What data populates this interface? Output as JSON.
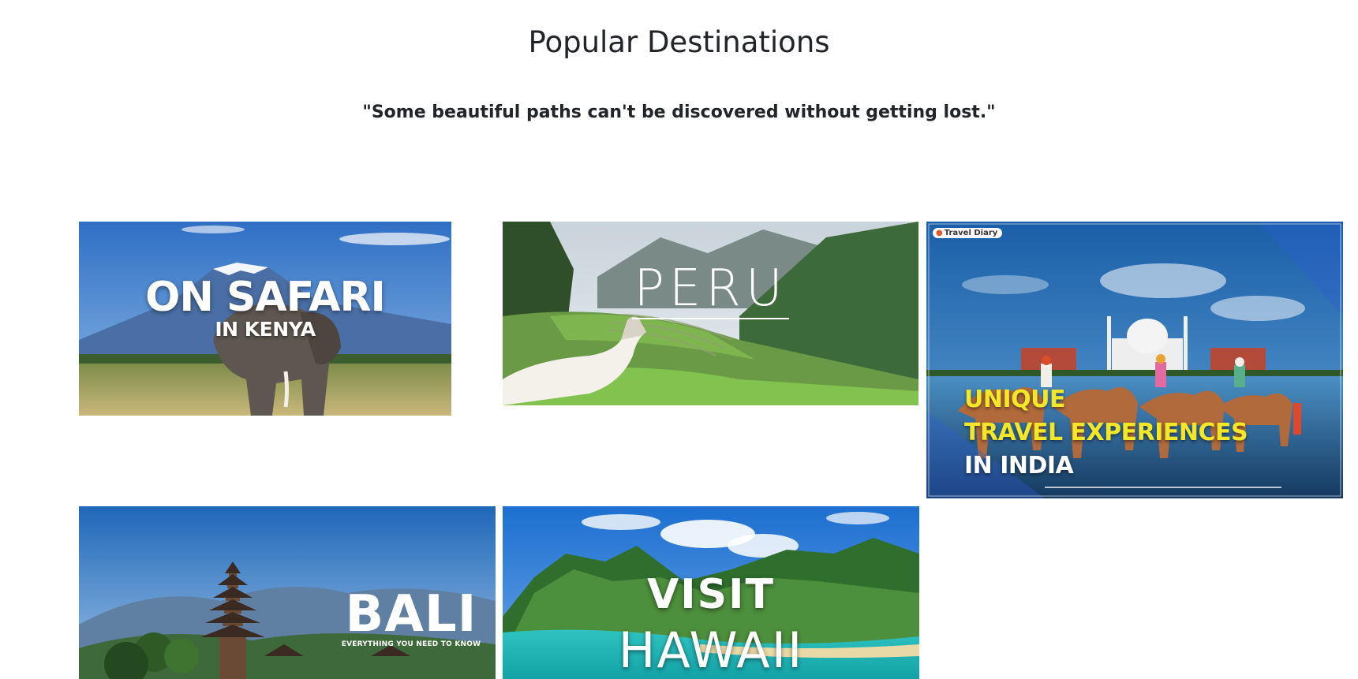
{
  "header": {
    "title": "Popular Destinations",
    "quote": "\"Some beautiful paths can't be discovered without getting lost.\""
  },
  "destinations": [
    {
      "id": "kenya",
      "title": "ON SAFARI",
      "subtitle": "IN KENYA"
    },
    {
      "id": "peru",
      "title": "PERU"
    },
    {
      "id": "india",
      "logo": "Travel Diary",
      "lines": [
        "UNIQUE",
        "TRAVEL EXPERIENCES",
        "IN INDIA"
      ],
      "colors": {
        "highlight": "#f4e728",
        "base": "#ffffff"
      }
    },
    {
      "id": "bali",
      "title": "BALI",
      "subtitle": "EVERYTHING YOU NEED TO KNOW"
    },
    {
      "id": "hawaii",
      "title": "VISIT",
      "subtitle": "HAWAII"
    }
  ]
}
